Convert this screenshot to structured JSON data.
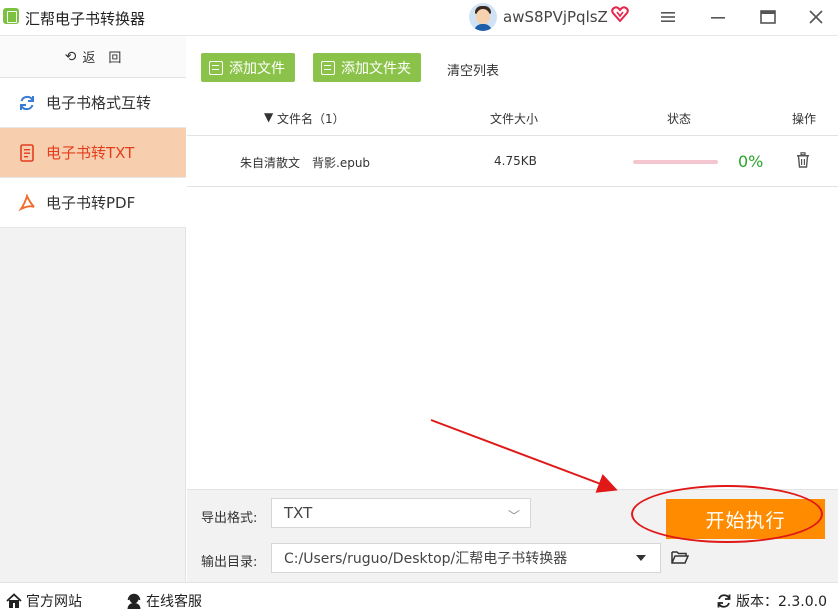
{
  "window": {
    "title": "汇帮电子书转换器",
    "username": "awS8PVjPqlsZ"
  },
  "sidebar": {
    "back_label": "返　回",
    "items": [
      {
        "label": "电子书格式互转",
        "icon": "refresh-icon"
      },
      {
        "label": "电子书转TXT",
        "icon": "document-icon",
        "active": true
      },
      {
        "label": "电子书转PDF",
        "icon": "pdf-icon"
      }
    ]
  },
  "toolbar": {
    "add_file": "添加文件",
    "add_folder": "添加文件夹",
    "clear_list": "清空列表"
  },
  "table": {
    "headers": {
      "name": "文件名（1）",
      "size": "文件大小",
      "status": "状态",
      "action": "操作"
    },
    "rows": [
      {
        "name": "朱自清散文　背影.epub",
        "size": "4.75KB",
        "progress": 0,
        "percent": "0%"
      }
    ]
  },
  "bottom": {
    "format_label": "导出格式:",
    "format_value": "TXT",
    "dir_label": "输出目录:",
    "dir_value": "C:/Users/ruguo/Desktop/汇帮电子书转换器",
    "start_label": "开始执行"
  },
  "statusbar": {
    "website": "官方网站",
    "support": "在线客服",
    "version": "版本：2.3.0.0"
  },
  "colors": {
    "accent_green": "#8bc34a",
    "active_bg": "#f8cfae",
    "active_text": "#e43d1e",
    "start_orange": "#ff8c00",
    "annotation_red": "#e01818"
  }
}
